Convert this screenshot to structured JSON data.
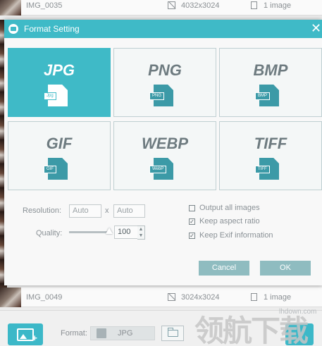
{
  "background_list": {
    "rows": [
      {
        "name": "IMG_0035",
        "dimensions": "4032x3024",
        "count": "1 image"
      },
      {
        "name": "IMG_0049",
        "dimensions": "3024x3024",
        "count": "1 image"
      }
    ]
  },
  "dialog": {
    "title": "Format Setting",
    "close_glyph": "✕",
    "formats": [
      {
        "name": "JPG",
        "tag": "Jpg",
        "selected": true
      },
      {
        "name": "PNG",
        "tag": "PNG",
        "selected": false
      },
      {
        "name": "BMP",
        "tag": "BMP",
        "selected": false
      },
      {
        "name": "GIF",
        "tag": "GIF",
        "selected": false
      },
      {
        "name": "WEBP",
        "tag": "WebP",
        "selected": false
      },
      {
        "name": "TIFF",
        "tag": "TIFF",
        "selected": false
      }
    ],
    "resolution": {
      "label": "Resolution:",
      "width_placeholder": "Auto",
      "separator": "x",
      "height_placeholder": "Auto"
    },
    "quality": {
      "label": "Quality:",
      "value": "100"
    },
    "options": [
      {
        "label": "Output all images",
        "checked": false
      },
      {
        "label": "Keep aspect ratio",
        "checked": true
      },
      {
        "label": "Keep Exif information",
        "checked": true
      }
    ],
    "cancel_label": "Cancel",
    "ok_label": "OK"
  },
  "toolbar": {
    "format_label": "Format:",
    "format_value": "JPG"
  },
  "watermark": {
    "text": "领航下载",
    "site": "lhdown.com"
  },
  "colors": {
    "accent": "#3fbac7",
    "button_muted": "#8fbcc0"
  }
}
